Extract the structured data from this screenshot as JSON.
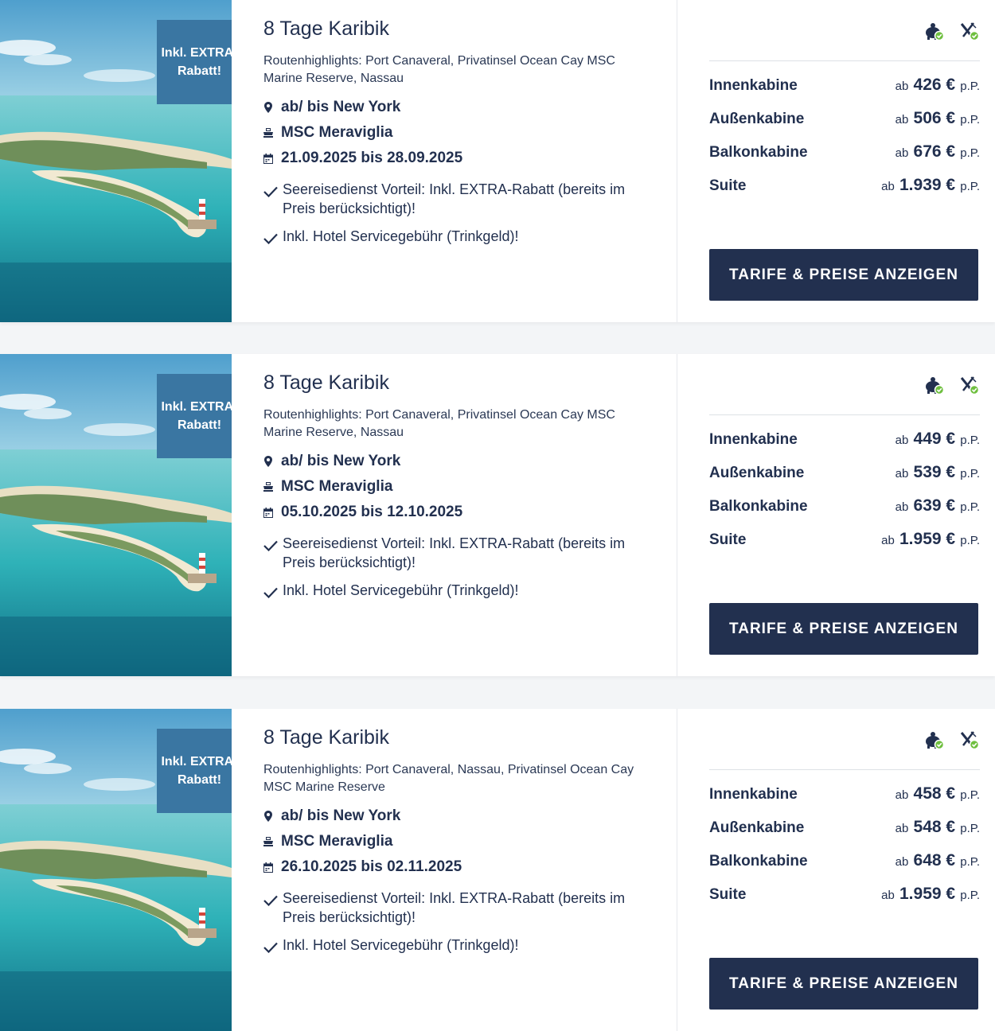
{
  "offers": [
    {
      "badge": "Inkl. EXTRA-Rabatt!",
      "title": "8 Tage Karibik",
      "route": "Routenhighlights: Port Canaveral, Privatinsel Ocean Cay MSC Marine Reserve, Nassau",
      "port": "ab/ bis New York",
      "ship": "MSC Meraviglia",
      "dates": "21.09.2025 bis 28.09.2025",
      "benefits": [
        "Seereisedienst Vorteil: Inkl. EXTRA-Rabatt (bereits im Preis berücksichtigt)!",
        "Inkl. Hotel Servicegebühr (Trinkgeld)!"
      ],
      "prices": [
        {
          "cabin": "Innenkabine",
          "prefix": "ab",
          "amount": "426 €",
          "suffix": "p.P."
        },
        {
          "cabin": "Außenkabine",
          "prefix": "ab",
          "amount": "506 €",
          "suffix": "p.P."
        },
        {
          "cabin": "Balkonkabine",
          "prefix": "ab",
          "amount": "676 €",
          "suffix": "p.P."
        },
        {
          "cabin": "Suite",
          "prefix": "ab",
          "amount": "1.939 €",
          "suffix": "p.P."
        }
      ],
      "button": "TARIFE & PREISE ANZEIGEN"
    },
    {
      "badge": "Inkl. EXTRA-Rabatt!",
      "title": "8 Tage Karibik",
      "route": "Routenhighlights: Port Canaveral, Privatinsel Ocean Cay MSC Marine Reserve, Nassau",
      "port": "ab/ bis New York",
      "ship": "MSC Meraviglia",
      "dates": "05.10.2025 bis 12.10.2025",
      "benefits": [
        "Seereisedienst Vorteil: Inkl. EXTRA-Rabatt (bereits im Preis berücksichtigt)!",
        "Inkl. Hotel Servicegebühr (Trinkgeld)!"
      ],
      "prices": [
        {
          "cabin": "Innenkabine",
          "prefix": "ab",
          "amount": "449 €",
          "suffix": "p.P."
        },
        {
          "cabin": "Außenkabine",
          "prefix": "ab",
          "amount": "539 €",
          "suffix": "p.P."
        },
        {
          "cabin": "Balkonkabine",
          "prefix": "ab",
          "amount": "639 €",
          "suffix": "p.P."
        },
        {
          "cabin": "Suite",
          "prefix": "ab",
          "amount": "1.959 €",
          "suffix": "p.P."
        }
      ],
      "button": "TARIFE & PREISE ANZEIGEN"
    },
    {
      "badge": "Inkl. EXTRA-Rabatt!",
      "title": "8 Tage Karibik",
      "route": "Routenhighlights: Port Canaveral, Nassau, Privatinsel Ocean Cay MSC Marine Reserve",
      "port": "ab/ bis New York",
      "ship": "MSC Meraviglia",
      "dates": "26.10.2025 bis 02.11.2025",
      "benefits": [
        "Seereisedienst Vorteil: Inkl. EXTRA-Rabatt (bereits im Preis berücksichtigt)!",
        "Inkl. Hotel Servicegebühr (Trinkgeld)!"
      ],
      "prices": [
        {
          "cabin": "Innenkabine",
          "prefix": "ab",
          "amount": "458 €",
          "suffix": "p.P."
        },
        {
          "cabin": "Außenkabine",
          "prefix": "ab",
          "amount": "548 €",
          "suffix": "p.P."
        },
        {
          "cabin": "Balkonkabine",
          "prefix": "ab",
          "amount": "648 €",
          "suffix": "p.P."
        },
        {
          "cabin": "Suite",
          "prefix": "ab",
          "amount": "1.959 €",
          "suffix": "p.P."
        }
      ],
      "button": "TARIFE & PREISE ANZEIGEN"
    }
  ],
  "icons": {
    "feature_1": "piggy-bank-check-icon",
    "feature_2": "cutlery-check-icon",
    "location": "location-pin-icon",
    "ship": "ship-icon",
    "calendar": "calendar-icon",
    "check": "checkmark-icon"
  },
  "colors": {
    "navy": "#22304f",
    "badge_blue": "#3a76a2",
    "check_green": "#6fbf3f"
  }
}
